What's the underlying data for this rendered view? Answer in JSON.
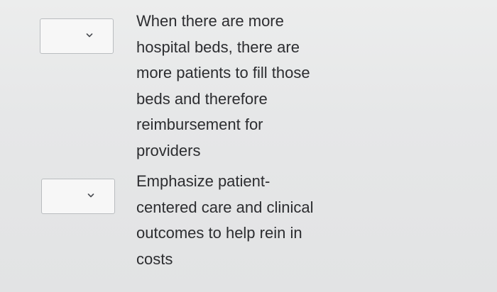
{
  "items": [
    {
      "select": {
        "value": "",
        "icon": "chevron-down-icon"
      },
      "text": "When there are more\nhospital beds, there are\nmore patients to fill those\nbeds and therefore\nreimbursement for\nproviders"
    },
    {
      "select": {
        "value": "",
        "icon": "chevron-down-icon"
      },
      "text": "Emphasize patient-\ncentered care and clinical\noutcomes to help rein in\ncosts"
    }
  ]
}
